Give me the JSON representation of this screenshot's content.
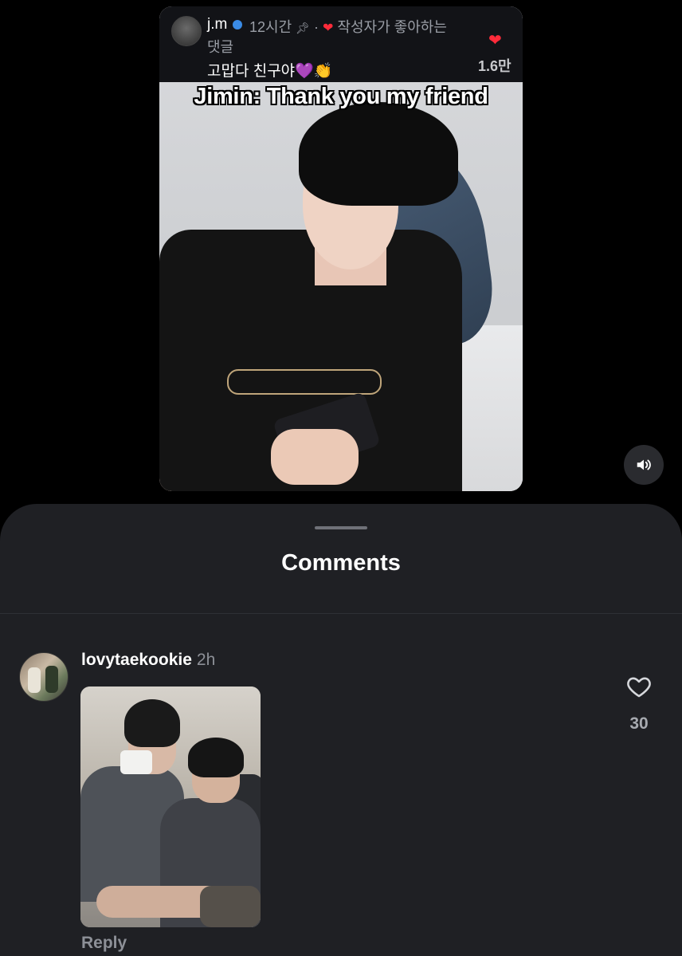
{
  "video": {
    "comment_header": {
      "username": "j.m",
      "time": "12시간",
      "pin_icon": "pin-icon",
      "liked_label": "작성자가 좋아하는",
      "liked_label_line2": "댓글",
      "comment_text": "고맙다 친구야💜👏",
      "like_count": "1.6만"
    },
    "subtitle": "Jimin: Thank you my friend"
  },
  "controls": {
    "mute_icon": "speaker-icon"
  },
  "comments_sheet": {
    "title": "Comments",
    "comments": [
      {
        "username": "lovytaekookie",
        "time": "2h",
        "reply_label": "Reply",
        "like_count": "30"
      }
    ]
  },
  "colors": {
    "sheet_background": "#1f2024",
    "heart_red": "#ff2b3a",
    "verified_blue": "#3a8be6",
    "muted_text": "#8d9097"
  }
}
